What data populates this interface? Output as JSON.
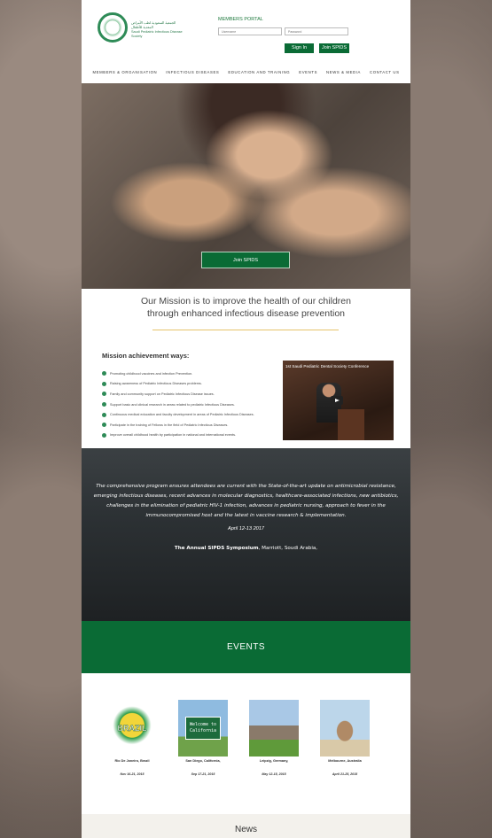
{
  "header": {
    "logo_text_ar": "الجمعية السعودية لطب الأمراض المعدية للأطفال",
    "logo_text_en": "Saudi Pediatric Infectious Disease Society",
    "logo_badge": "SPIDS",
    "members_portal": "MEMBERS PORTAL",
    "username_placeholder": "Username",
    "password_placeholder": "Password",
    "sign_in": "Sign In",
    "join": "Join SPIDS"
  },
  "nav": [
    "MEMBERS & ORGANISATION",
    "INFECTIOUS DISEASES",
    "EDUCATION AND TRAINING",
    "EVENTS",
    "NEWS & MEDIA",
    "CONTACT US"
  ],
  "hero": {
    "button": "Join SPIDS"
  },
  "mission": {
    "title_line1": "Our Mission is to improve the health of our children",
    "title_line2": "through enhanced infectious disease prevention",
    "ways_title": "Mission achievement ways:",
    "ways": [
      "Promoting childhood vaccines and infection Prevention.",
      "Raising awareness of Pediatric Infectious Diseases problems.",
      "Family and community support on Pediatric Infectious Disease issues.",
      "Support basic and clinical research in areas related to pediatric Infectious Diseases.",
      "Continuous medical education and faculty development in areas of Pediatric Infectious Diseases.",
      "Participate in the training of Fellows in the field of Pediatric Infectious Diseases.",
      "Improve overall childhood health by participation in national and international events."
    ],
    "video_title": "1st Saudi Pediatric Dental Society Conference"
  },
  "program": {
    "text": "The comprehensive program ensures attendees are current with the State-of-the-art update on antimicrobial resistance, emerging infectious diseases, recent advances in molecular diagnostics, healthcare-associated infections, new antibiotics, challenges in the elimination of pediatric HIV-1 infection, advances in pediatric nursing, approach to fever in the immunocompromised host and the latest in vaccine research & implementation.",
    "date": "April 12-13 2017",
    "symposium_bold": "The Annual SIPDS Symposium",
    "symposium_rest": ", Marriott, Soudi Arabia,"
  },
  "events": {
    "title": "EVENTS",
    "items": [
      {
        "city": "Rio De Janeiro, Brazil",
        "date": "Nov 16-21, 2015",
        "image_label": "BRAZIL"
      },
      {
        "city": "San Diego, California,",
        "date": "Sep 17-21, 2015",
        "image_label": "Welcome to California"
      },
      {
        "city": "Leipzig, Germany,",
        "date": "May 12-15, 2015",
        "image_label": ""
      },
      {
        "city": "Melbourne, Australia",
        "date": "April 21-25, 2015",
        "image_label": ""
      }
    ]
  },
  "news": {
    "title": "News"
  }
}
